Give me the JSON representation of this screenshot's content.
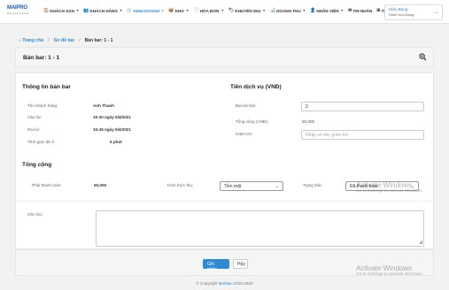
{
  "logo": {
    "brand": "MAIPRO",
    "sub": "Business Software"
  },
  "nav": [
    {
      "icon": "🏠",
      "label": "KHÁCH SẠN",
      "active": false
    },
    {
      "icon": "👥",
      "label": "KHÁCH HÀNG",
      "active": false
    },
    {
      "icon": "🛒",
      "label": "KINH DOANH",
      "active": true
    },
    {
      "icon": "📦",
      "label": "KHO",
      "active": false
    },
    {
      "icon": "📄",
      "label": "HÓA ĐƠN",
      "active": false
    },
    {
      "icon": "🏷",
      "label": "KHUYẾN MẠI",
      "active": false
    },
    {
      "icon": "📊",
      "label": "DOANH THU",
      "active": false
    },
    {
      "icon": "👤",
      "label": "NHÂN VIÊN",
      "active": false
    },
    {
      "icon": "✉",
      "label": "TIN NHẮN",
      "active": false
    },
    {
      "icon": "⊞",
      "label": "THÊM",
      "active": false
    }
  ],
  "user": {
    "name": "Hiếu Bảng",
    "hotel": "Hotel Hùu Bang"
  },
  "breadcrumb": {
    "home": "Trang chủ",
    "map": "Sơ đồ bar",
    "current": "Bàn bar: 1 - 1"
  },
  "page": {
    "title": "Bàn bar: 1 - 1"
  },
  "info": {
    "title": "Thông tin bàn bar",
    "customer_label": "Tên khách hàng:",
    "customer_value": "Anh Thanh",
    "checkin_label": "Vào lúc:",
    "checkin_value": "15:40 ngày 5/4/2021",
    "checkout_label": "Ra lúc:",
    "checkout_value": "15:45 ngày 5/4/2021",
    "duration_label": "Thời gian đã ở:",
    "duration_value": "5 phút"
  },
  "service": {
    "title": "Tiền dịch vụ (VNĐ)",
    "beer_label": "Bia Hà Nội:",
    "beer_value": "2",
    "total_label": "Tổng cộng (VNĐ):",
    "total_value": "50,000",
    "discount_label": "Giảm trừ:",
    "discount_placeholder": "Nhập số tiền giảm trừ"
  },
  "summary": {
    "title": "Tổng cộng",
    "pay_label": "Phải thanh toán:",
    "pay_value": "50,000",
    "method_label": "Hình thức thu:",
    "method_value": "Tiền mặt",
    "status_label": "Trạng thái:",
    "status_value": "Đã thanh toán"
  },
  "note": {
    "label": "Ghi chú:"
  },
  "actions": {
    "confirm": "Ghi nhận",
    "cancel": "Hủy"
  },
  "footer": {
    "prefix": "© Copyright",
    "brand": "MaiMau",
    "years": "2015-2020"
  },
  "watermark": {
    "title": "Activate Windows",
    "sub": "Go to Settings to activate Windows."
  }
}
